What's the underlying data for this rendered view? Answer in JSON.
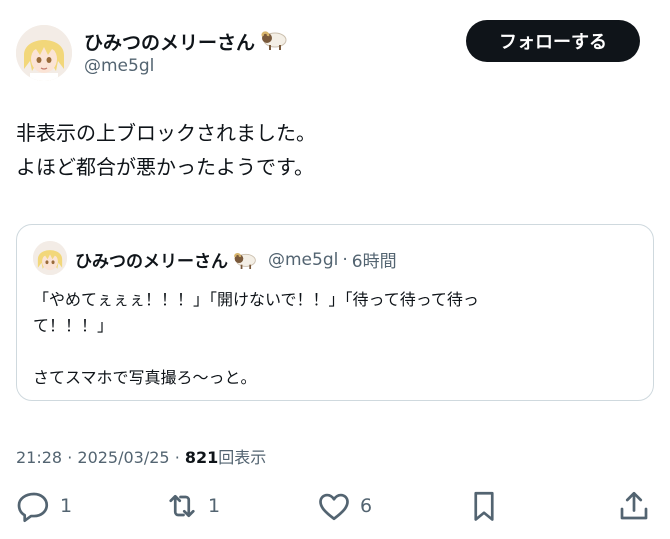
{
  "author": {
    "display_name": "ひみつのメリーさん",
    "handle": "@me5gl",
    "avatar_icon": "anime-avatar-icon",
    "emoji_icon": "ram-icon"
  },
  "follow_button": {
    "label": "フォローする"
  },
  "tweet": {
    "lines": [
      "非表示の上ブロックされました。",
      "よほど都合が悪かったようです。"
    ]
  },
  "quote": {
    "display_name": "ひみつのメリーさん",
    "handle": "@me5gl",
    "separator": "·",
    "time": "6時間",
    "line1": "「やめてぇぇぇ！！！」「開けないで！！」「待って待って待っ",
    "line2": "て！！！」",
    "line3": "さてスマホで写真撮ろ〜っと。"
  },
  "meta": {
    "time": "21:28",
    "date": "2025/03/25",
    "views_count": "821",
    "views_label": "回表示",
    "sep": "·"
  },
  "actions": {
    "reply_count": "1",
    "retweet_count": "1",
    "like_count": "6"
  },
  "colors": {
    "text": "#0f1419",
    "muted": "#536471",
    "border": "#cfd9de",
    "button": "#0f1419"
  }
}
